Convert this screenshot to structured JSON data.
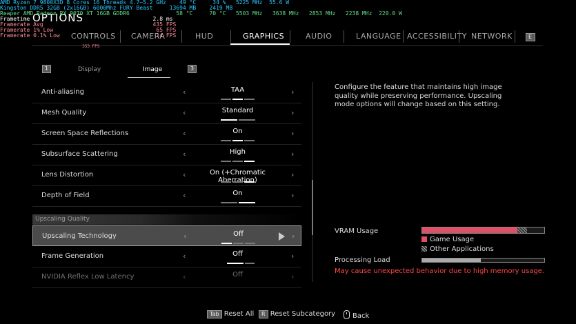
{
  "overlay": {
    "lines": [
      {
        "text": "AMD Ryzen 7 9800X3D 8 Cores 16 Threads 4.7~5.2 GHz    49 °C     34 %   5225 MHz  55.6 W",
        "color": "cyan"
      },
      {
        "text": "Kingston DDR5 32GB (2x16GB) 6000Mhz FURY Beast     13694 MB    2419 MB",
        "color": "cyan"
      },
      {
        "text": "Reaper AMD Radeon RX 9070 XT 16GB GDDR6              58 °C     70 °C   5503 MHz   3638 MHz   2853 MHz   2238 MHz  220.0 W",
        "color": "green"
      },
      {
        "text": "Frametime                                     2.8 ms",
        "color": "white"
      },
      {
        "text": "Framerate Avg                                 435 FPS",
        "color": "pink"
      },
      {
        "text": "Framerate 1% Low                               65 FPS",
        "color": "pink"
      },
      {
        "text": "Framerate 0.1% Low                             14 FPS",
        "color": "pink"
      },
      {
        "text": "                                 353 FPS",
        "color": "pink"
      }
    ]
  },
  "title": "OPTIONS",
  "tabs": [
    {
      "label": "CONTROLS"
    },
    {
      "label": "CAMERA"
    },
    {
      "label": "HUD"
    },
    {
      "label": "GRAPHICS"
    },
    {
      "label": "AUDIO"
    },
    {
      "label": "LANGUAGE"
    },
    {
      "label": "ACCESSIBILITY"
    },
    {
      "label": "NETWORK"
    }
  ],
  "tab_nav_keys": {
    "next": "E"
  },
  "subtabs": [
    {
      "key": "1"
    },
    {
      "label": "Display"
    },
    {
      "label": "Image"
    },
    {
      "key": "3"
    }
  ],
  "settings": [
    {
      "label": "Anti-aliasing",
      "value": "TAA"
    },
    {
      "label": "Mesh Quality",
      "value": "Standard"
    },
    {
      "label": "Screen Space Reflections",
      "value": "On"
    },
    {
      "label": "Subsurface Scattering",
      "value": "High"
    },
    {
      "label": "Lens Distortion",
      "value": "On (+Chromatic Aberration)"
    },
    {
      "label": "Depth of Field",
      "value": "On"
    }
  ],
  "group_header": "Upscaling Quality",
  "upscaling_settings": [
    {
      "label": "Upscaling Technology",
      "value": "Off"
    },
    {
      "label": "Frame Generation",
      "value": "Off"
    },
    {
      "label": "NVIDIA Reflex Low Latency",
      "value": "Off"
    }
  ],
  "arrows": {
    "left": "‹",
    "right": "›"
  },
  "description": "Configure the feature that maintains high image quality while preserving performance. Upscaling mode options will change based on this setting.",
  "vram": {
    "label": "VRAM Usage",
    "game_fraction": 0.78,
    "other_fraction": 0.08,
    "legend_game": "Game Usage",
    "legend_other": "Other Applications",
    "game_color": "#e05065"
  },
  "processing": {
    "label": "Processing Load",
    "fraction": 0.48
  },
  "warning": "May cause unexpected behavior due to high memory usage.",
  "footer": {
    "reset_all_key": "Tab",
    "reset_all": "Reset All",
    "reset_sub_key": "R",
    "reset_sub": "Reset Subcategory",
    "back": "Back"
  }
}
